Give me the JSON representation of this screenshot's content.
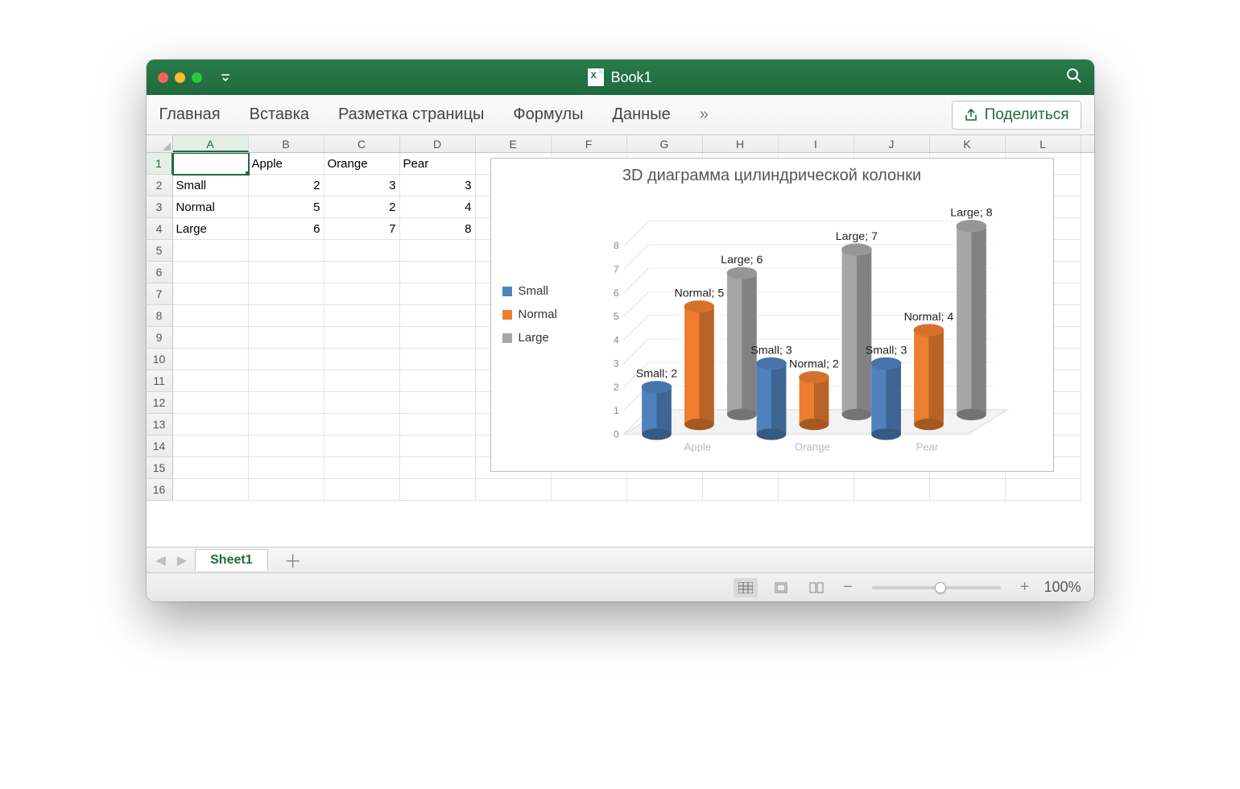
{
  "window": {
    "title": "Book1"
  },
  "ribbon": {
    "tabs": [
      "Главная",
      "Вставка",
      "Разметка страницы",
      "Формулы",
      "Данные"
    ],
    "more": "»",
    "share": "Поделиться"
  },
  "columns": [
    "A",
    "B",
    "C",
    "D",
    "E",
    "F",
    "G",
    "H",
    "I",
    "J",
    "K",
    "L"
  ],
  "rows": [
    "1",
    "2",
    "3",
    "4",
    "5",
    "6",
    "7",
    "8",
    "9",
    "10",
    "11",
    "12",
    "13",
    "14",
    "15",
    "16"
  ],
  "cells": {
    "B1": "Apple",
    "C1": "Orange",
    "D1": "Pear",
    "A2": "Small",
    "B2": "2",
    "C2": "3",
    "D2": "3",
    "A3": "Normal",
    "B3": "5",
    "C3": "2",
    "D3": "4",
    "A4": "Large",
    "B4": "6",
    "C4": "7",
    "D4": "8"
  },
  "selected_cell": "A1",
  "sheet": {
    "name": "Sheet1"
  },
  "status": {
    "zoom": "100%"
  },
  "colors": {
    "small": "#4f81bd",
    "normal": "#ed7d31",
    "large": "#a6a6a6"
  },
  "chart_data": {
    "type": "bar",
    "title": "3D диаграмма цилиндрической колонки",
    "categories": [
      "Apple",
      "Orange",
      "Pear"
    ],
    "series": [
      {
        "name": "Small",
        "values": [
          2,
          3,
          3
        ]
      },
      {
        "name": "Normal",
        "values": [
          5,
          2,
          4
        ]
      },
      {
        "name": "Large",
        "values": [
          6,
          7,
          8
        ]
      }
    ],
    "ylim": [
      0,
      8
    ],
    "yticks": [
      0,
      1,
      2,
      3,
      4,
      5,
      6,
      7,
      8
    ],
    "xlabel": "",
    "ylabel": ""
  }
}
